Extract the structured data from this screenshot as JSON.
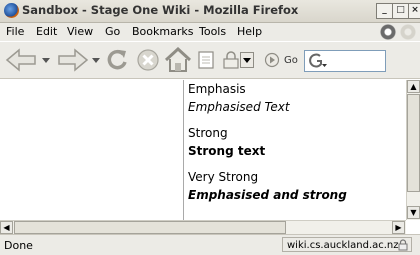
{
  "window": {
    "title": "Sandbox - Stage One Wiki - Mozilla Firefox"
  },
  "menu": {
    "items": [
      "File",
      "Edit",
      "View",
      "Go",
      "Bookmarks",
      "Tools",
      "Help"
    ]
  },
  "toolbar": {
    "go_label": "Go",
    "icons": [
      "back-arrow-icon",
      "forward-arrow-icon",
      "reload-icon",
      "stop-icon",
      "home-icon",
      "page-icon",
      "lock-icon",
      "go-icon",
      "google-search-icon"
    ]
  },
  "content": {
    "lines": [
      {
        "text": "Emphasis",
        "style": "normal"
      },
      {
        "text": "Emphasised Text",
        "style": "italic"
      },
      {
        "text": "Strong",
        "style": "normal"
      },
      {
        "text": "Strong text",
        "style": "bold"
      },
      {
        "text": "Very Strong",
        "style": "normal"
      },
      {
        "text": "Emphasised and strong",
        "style": "bold-italic"
      }
    ]
  },
  "status": {
    "text": "Done",
    "url": "wiki.cs.auckland.ac.nz"
  }
}
